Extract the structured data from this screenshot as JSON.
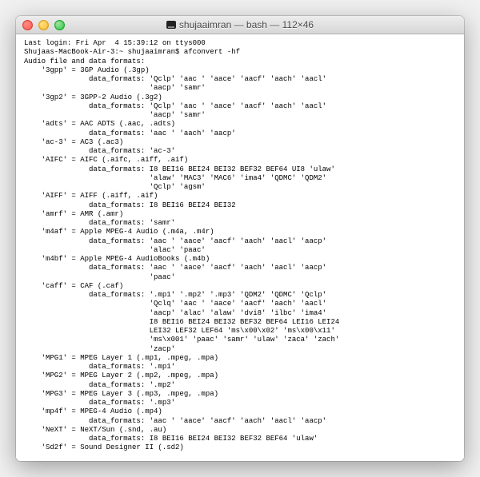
{
  "window": {
    "title": "shujaaimran — bash — 112×46"
  },
  "terminal": {
    "lines": [
      "Last login: Fri Apr  4 15:39:12 on ttys000",
      "Shujaas-MacBook-Air-3:~ shujaaimran$ afconvert -hf",
      "Audio file and data formats:",
      "    '3gpp' = 3GP Audio (.3gp)",
      "               data_formats: 'Qclp' 'aac ' 'aace' 'aacf' 'aach' 'aacl' ",
      "                             'aacp' 'samr' ",
      "    '3gp2' = 3GPP-2 Audio (.3g2)",
      "               data_formats: 'Qclp' 'aac ' 'aace' 'aacf' 'aach' 'aacl' ",
      "                             'aacp' 'samr' ",
      "    'adts' = AAC ADTS (.aac, .adts)",
      "               data_formats: 'aac ' 'aach' 'aacp' ",
      "    'ac-3' = AC3 (.ac3)",
      "               data_formats: 'ac-3' ",
      "    'AIFC' = AIFC (.aifc, .aiff, .aif)",
      "               data_formats: I8 BEI16 BEI24 BEI32 BEF32 BEF64 UI8 'ulaw' ",
      "                             'alaw' 'MAC3' 'MAC6' 'ima4' 'QDMC' 'QDM2' ",
      "                             'Qclp' 'agsm' ",
      "    'AIFF' = AIFF (.aiff, .aif)",
      "               data_formats: I8 BEI16 BEI24 BEI32 ",
      "    'amrf' = AMR (.amr)",
      "               data_formats: 'samr' ",
      "    'm4af' = Apple MPEG-4 Audio (.m4a, .m4r)",
      "               data_formats: 'aac ' 'aace' 'aacf' 'aach' 'aacl' 'aacp' ",
      "                             'alac' 'paac' ",
      "    'm4bf' = Apple MPEG-4 AudioBooks (.m4b)",
      "               data_formats: 'aac ' 'aace' 'aacf' 'aach' 'aacl' 'aacp' ",
      "                             'paac' ",
      "    'caff' = CAF (.caf)",
      "               data_formats: '.mp1' '.mp2' '.mp3' 'QDM2' 'QDMC' 'Qclp' ",
      "                             'Qclq' 'aac ' 'aace' 'aacf' 'aach' 'aacl' ",
      "                             'aacp' 'alac' 'alaw' 'dvi8' 'ilbc' 'ima4' ",
      "                             I8 BEI16 BEI24 BEI32 BEF32 BEF64 LEI16 LEI24 ",
      "                             LEI32 LEF32 LEF64 'ms\\x00\\x02' 'ms\\x00\\x11' ",
      "                             'ms\\x001' 'paac' 'samr' 'ulaw' 'zaca' 'zach' ",
      "                             'zacp' ",
      "    'MPG1' = MPEG Layer 1 (.mp1, .mpeg, .mpa)",
      "               data_formats: '.mp1' ",
      "    'MPG2' = MPEG Layer 2 (.mp2, .mpeg, .mpa)",
      "               data_formats: '.mp2' ",
      "    'MPG3' = MPEG Layer 3 (.mp3, .mpeg, .mpa)",
      "               data_formats: '.mp3' ",
      "    'mp4f' = MPEG-4 Audio (.mp4)",
      "               data_formats: 'aac ' 'aace' 'aacf' 'aach' 'aacl' 'aacp' ",
      "    'NeXT' = NeXT/Sun (.snd, .au)",
      "               data_formats: I8 BEI16 BEI24 BEI32 BEF32 BEF64 'ulaw' ",
      "    'Sd2f' = Sound Designer II (.sd2)"
    ]
  }
}
